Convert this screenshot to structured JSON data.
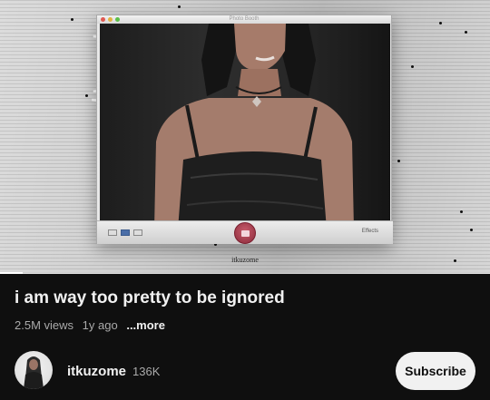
{
  "video": {
    "app_title": "Photo Booth",
    "effects_label": "Effects",
    "overlay_channel": "itkuzome",
    "progress": 0.047,
    "accent_colors": {
      "shutter": "#a23848",
      "selected_view": "#4a6ea8"
    }
  },
  "title": "i am way too pretty to be ignored",
  "meta": {
    "views": "2.5M views",
    "age": "1y ago",
    "more_label": "...more"
  },
  "channel": {
    "name": "itkuzome",
    "subscribers": "136K",
    "subscribe_label": "Subscribe"
  },
  "colors": {
    "background": "#0f0f0f",
    "primary_text": "#f1f1f1",
    "secondary_text": "#aaaaaa",
    "subscribe_bg": "#f1f1f1"
  }
}
